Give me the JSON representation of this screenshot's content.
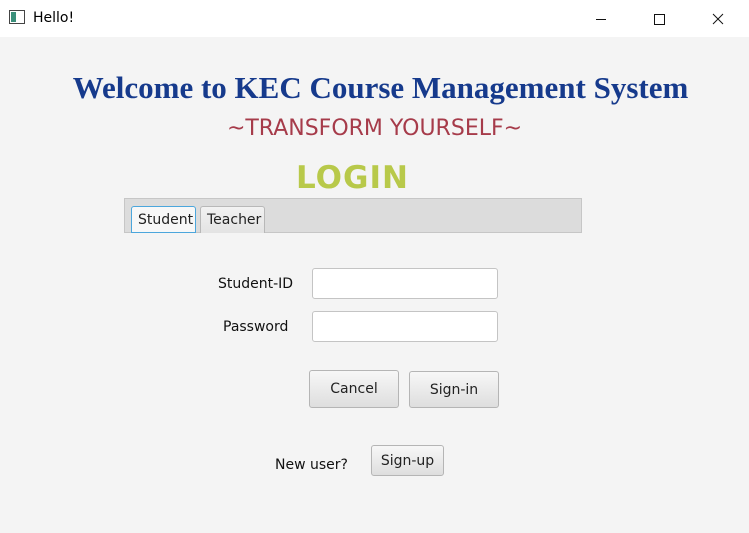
{
  "window": {
    "title": "Hello!"
  },
  "header": {
    "welcome": "Welcome to KEC Course Management System",
    "tagline": "~TRANSFORM YOURSELF~",
    "login": "LOGIN"
  },
  "tabs": [
    {
      "label": "Student",
      "selected": true
    },
    {
      "label": "Teacher",
      "selected": false
    }
  ],
  "form": {
    "id_label": "Student-ID",
    "id_value": "",
    "password_label": "Password",
    "password_value": "",
    "cancel_label": "Cancel",
    "signin_label": "Sign-in"
  },
  "signup": {
    "prompt": "New user?",
    "button_label": "Sign-up"
  },
  "colors": {
    "title_blue": "#163a8c",
    "tagline_red": "#a63b4a",
    "login_green": "#b8c94a",
    "tab_focus": "#4ba6dc"
  }
}
